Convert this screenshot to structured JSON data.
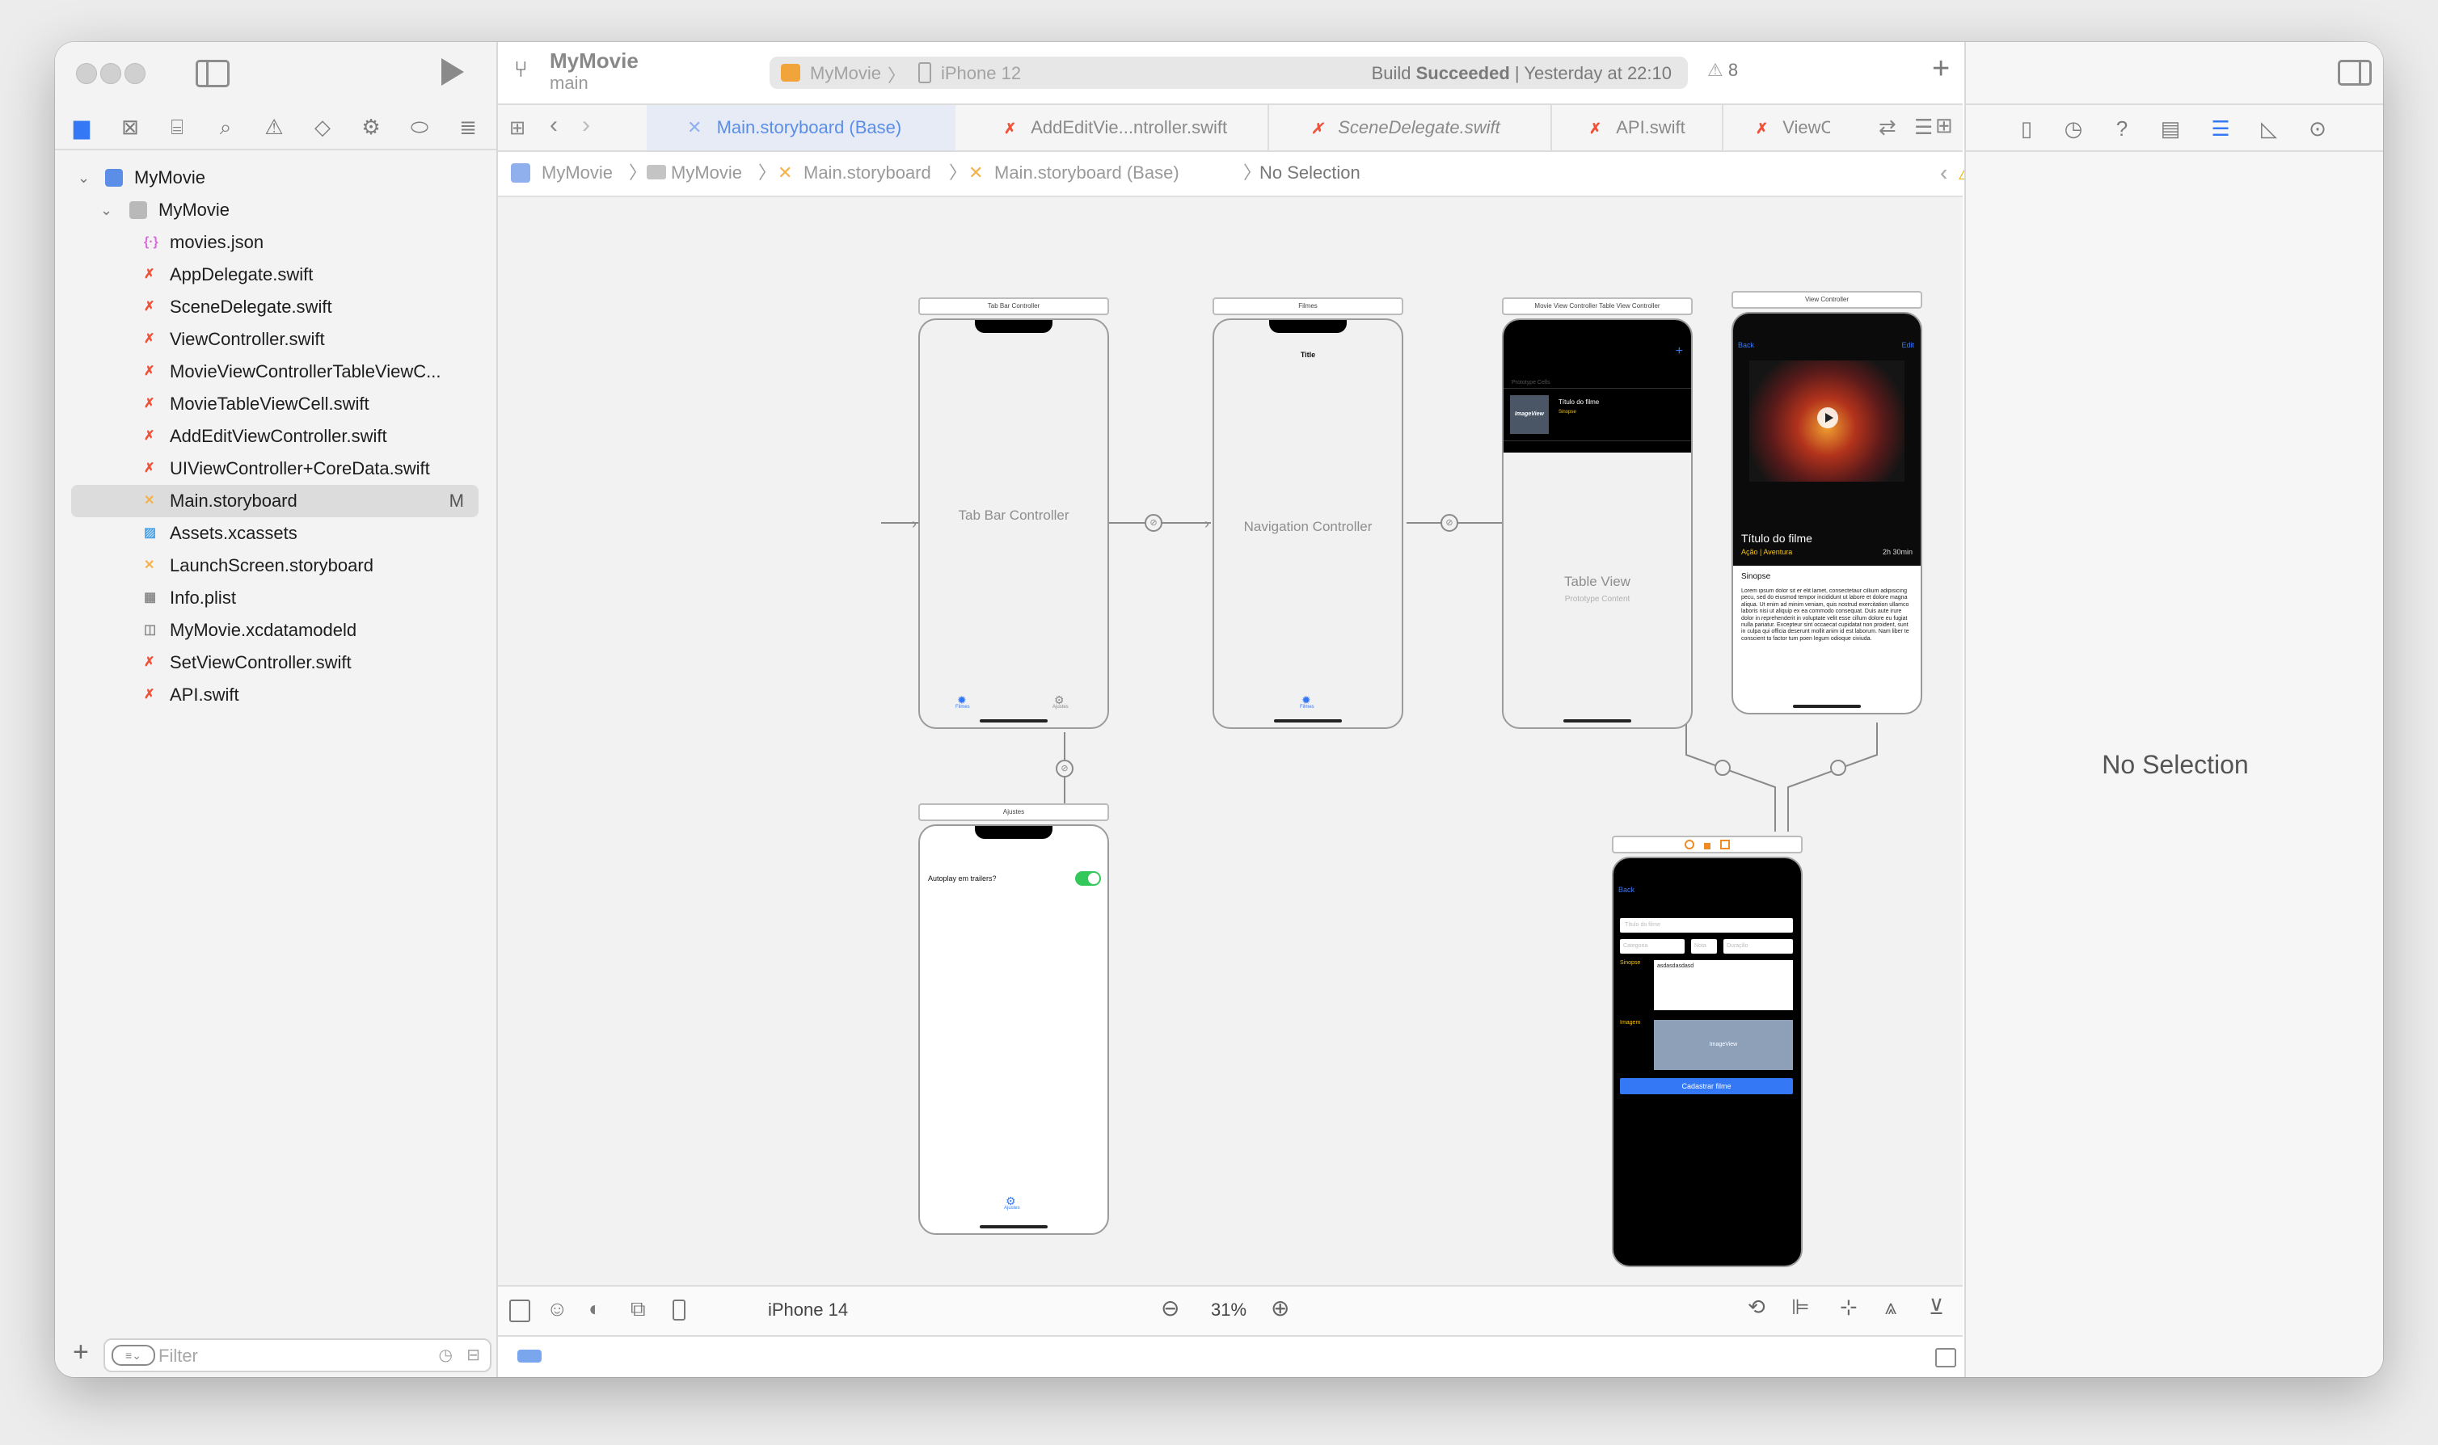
{
  "toolbar": {
    "project_name": "MyMovie",
    "branch": "main",
    "scheme_app": "MyMovie",
    "scheme_device": "iPhone 12",
    "build_status_prefix": "Build ",
    "build_status_result": "Succeeded",
    "build_status_time": "| Yesterday at 22:10",
    "warnings_count": "8"
  },
  "navigator": {
    "root": "MyMovie",
    "group": "MyMovie",
    "files": [
      {
        "name": "movies.json",
        "icon": "json-icon",
        "badge": ""
      },
      {
        "name": "AppDelegate.swift",
        "icon": "swift-icon",
        "badge": ""
      },
      {
        "name": "SceneDelegate.swift",
        "icon": "swift-icon",
        "badge": ""
      },
      {
        "name": "ViewController.swift",
        "icon": "swift-icon",
        "badge": ""
      },
      {
        "name": "MovieViewControllerTableViewC...",
        "icon": "swift-icon",
        "badge": ""
      },
      {
        "name": "MovieTableViewCell.swift",
        "icon": "swift-icon",
        "badge": ""
      },
      {
        "name": "AddEditViewController.swift",
        "icon": "swift-icon",
        "badge": ""
      },
      {
        "name": "UIViewController+CoreData.swift",
        "icon": "swift-icon",
        "badge": ""
      },
      {
        "name": "Main.storyboard",
        "icon": "storyboard-icon",
        "badge": "M"
      },
      {
        "name": "Assets.xcassets",
        "icon": "assets-icon",
        "badge": ""
      },
      {
        "name": "LaunchScreen.storyboard",
        "icon": "storyboard-icon",
        "badge": ""
      },
      {
        "name": "Info.plist",
        "icon": "plist-icon",
        "badge": ""
      },
      {
        "name": "MyMovie.xcdatamodeld",
        "icon": "datamodel-icon",
        "badge": ""
      },
      {
        "name": "SetViewController.swift",
        "icon": "swift-icon",
        "badge": ""
      },
      {
        "name": "API.swift",
        "icon": "swift-icon",
        "badge": ""
      }
    ],
    "filter_placeholder": "Filter"
  },
  "tabs": [
    {
      "label": "Main.storyboard (Base)",
      "active": true
    },
    {
      "label": "AddEditVie...ntroller.swift",
      "active": false
    },
    {
      "label": "SceneDelegate.swift",
      "active": false
    },
    {
      "label": "API.swift",
      "active": false
    },
    {
      "label": "ViewC",
      "active": false
    }
  ],
  "jumpbar": {
    "items": [
      "MyMovie",
      "MyMovie",
      "Main.storyboard",
      "Main.storyboard (Base)",
      "No Selection"
    ]
  },
  "storyboard": {
    "tab_bar_dock": "Tab Bar Controller",
    "tab_bar_title": "Tab Bar Controller",
    "tab_item_1": "Filmes",
    "tab_item_2": "Ajustes",
    "nav_dock": "Filmes",
    "nav_title": "Navigation Controller",
    "nav_bar_title": "Title",
    "nav_tab_item": "Filmes",
    "table_dock": "Movie View Controller Table View Controller",
    "table_prototype_cells": "Prototype Cells",
    "table_cell_image": "ImageView",
    "table_cell_title": "Título do filme",
    "table_cell_subtitle": "Sinopse",
    "table_title": "Table View",
    "table_subtitle": "Prototype Content",
    "vc_dock": "View Controller",
    "vc_back": "Back",
    "vc_edit": "Edit",
    "vc_movie_title": "Título do filme",
    "vc_genres": "Ação | Aventura",
    "vc_duration": "2h 30min",
    "vc_synopsis_label": "Sinopse",
    "vc_synopsis_text": "Lorem ipsum dolor sit er elit lamet, consectetaur cillium adipisicing pecu, sed do eiusmod tempor incididunt ut labore et dolore magna aliqua. Ut enim ad minim veniam, quis nostrud exercitation ullamco laboris nisi ut aliquip ex ea commodo consequat. Duis aute irure dolor in reprehenderit in voluptate velit esse cillum dolore eu fugiat nulla pariatur. Excepteur sint occaecat cupidatat non proident, sunt in culpa qui officia deserunt mollit anim id est laborum. Nam liber te conscient to factor tum poen legum odioque civiuda.",
    "settings_dock": "Ajustes",
    "settings_autoplay": "Autoplay em trailers?",
    "settings_tab_item": "Ajustes",
    "add_back": "Back",
    "add_title_placeholder": "Título do filme",
    "add_category_placeholder": "Categoria",
    "add_rating_placeholder": "Nota",
    "add_duration_placeholder": "Duração",
    "add_synopsis_label": "Sinopse",
    "add_synopsis_value": "asdasdasdasd",
    "add_image_label": "Imagem",
    "add_image_placeholder": "ImageView",
    "add_button": "Cadastrar filme"
  },
  "bottombar": {
    "device": "iPhone 14",
    "zoom": "31%"
  },
  "inspector": {
    "empty_text": "No Selection"
  },
  "colors": {
    "accent": "#3478f6",
    "swift": "#f05138",
    "switch_on": "#34c759",
    "warning": "#f5b100",
    "genre_yellow": "#f5c518"
  }
}
